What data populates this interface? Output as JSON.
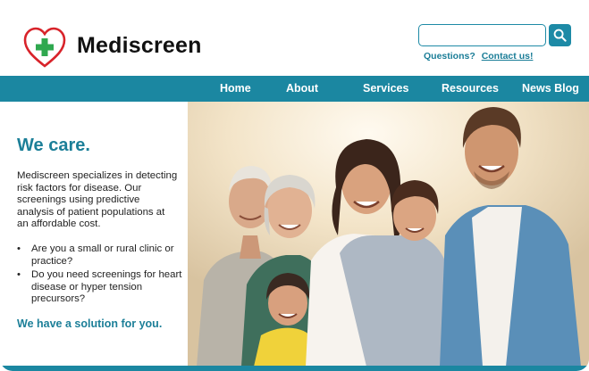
{
  "brand": {
    "name": "Mediscreen",
    "accent": "#1b87a1",
    "heart_color": "#d8232a",
    "cross_color": "#2fa84f"
  },
  "header": {
    "search": {
      "value": "",
      "placeholder": "",
      "button_icon": "search-icon"
    },
    "questions_label": "Questions?",
    "contact_link": "Contact us!"
  },
  "nav": {
    "items": [
      {
        "label": "Home"
      },
      {
        "label": "About"
      },
      {
        "label": "Services"
      },
      {
        "label": "Resources"
      },
      {
        "label": "News Blog"
      }
    ]
  },
  "main": {
    "headline": "We care.",
    "intro": "Mediscreen specializes in detecting risk factors for disease. Our screenings using predictive analysis of patient populations at an affordable cost.",
    "bullets": [
      "Are you a small or rural clinic or practice?",
      "Do you need screenings for heart disease or hyper tension precursors?"
    ],
    "tagline": "We have a solution for you."
  },
  "hero": {
    "image": "family-photo"
  }
}
